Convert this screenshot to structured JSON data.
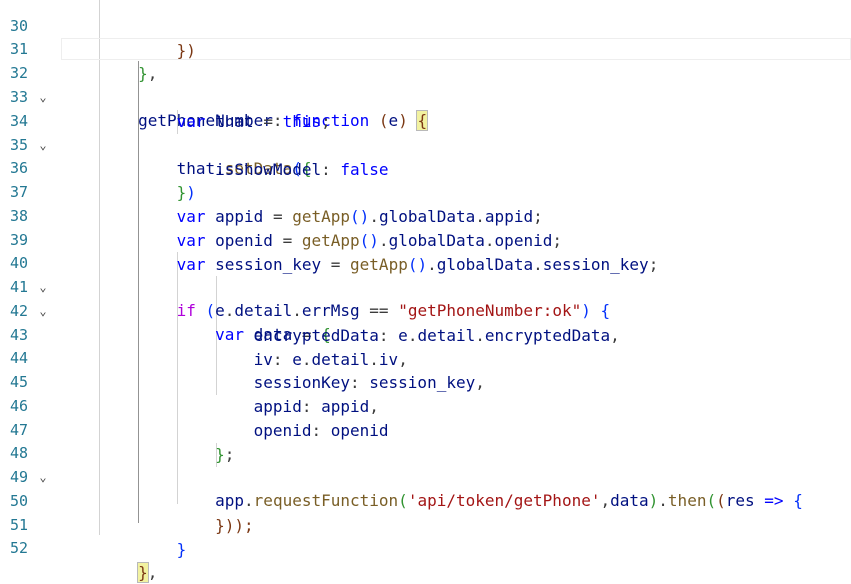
{
  "editor": {
    "line_numbers": [
      "30",
      "31",
      "32",
      "33",
      "34",
      "35",
      "36",
      "37",
      "38",
      "39",
      "40",
      "41",
      "42",
      "43",
      "44",
      "45",
      "46",
      "47",
      "48",
      "49",
      "50",
      "51",
      "52"
    ],
    "fold_icon": "chevron-down-icon",
    "fold_glyph": "⌄",
    "current_line": "32",
    "tokens": {
      "l30_close": "})",
      "l31_close": "}",
      "l31_comma": ",",
      "getPhoneNumber": "getPhoneNumber",
      "colon": ":",
      "function": "function",
      "paren_open": "(",
      "param_e": "e",
      "paren_close": ")",
      "brace_open": "{",
      "var": "var",
      "that": "that",
      "eq": "=",
      "this": "this",
      "semi": ";",
      "dot": ".",
      "setData": "setData",
      "isShowModel": "isShowModel",
      "false": "false",
      "brace_close": "}",
      "appid": "appid",
      "openid": "openid",
      "session_key": "session_key",
      "getApp": "getApp",
      "globalData": "globalData",
      "if": "if",
      "e": "e",
      "detail": "detail",
      "errMsg": "errMsg",
      "eqeq": "==",
      "ok_str": "\"getPhoneNumber:ok\"",
      "data": "data",
      "encryptedData": "encryptedData",
      "iv": "iv",
      "sessionKey": "sessionKey",
      "comma": ",",
      "app": "app",
      "requestFunction": "requestFunction",
      "api_str": "'api/token/getPhone'",
      "then": "then",
      "res": "res",
      "arrow": "=>",
      "l50_close": "}));",
      "l52_close": "}"
    }
  }
}
